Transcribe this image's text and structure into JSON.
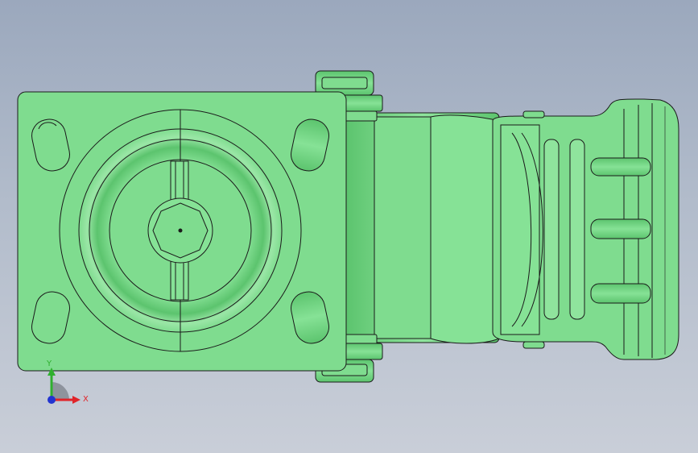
{
  "viewport": {
    "background_top": "#9ba8bd",
    "background_bottom": "#c9ced8"
  },
  "model": {
    "body_color": "#7fdc8f",
    "shade_color": "#5cc46e",
    "edge_color": "#1a1a1a"
  },
  "triad": {
    "x_label": "X",
    "y_label": "Y",
    "x_color": "#e0242a",
    "y_color": "#2fb02f",
    "z_color": "#2234d0"
  }
}
